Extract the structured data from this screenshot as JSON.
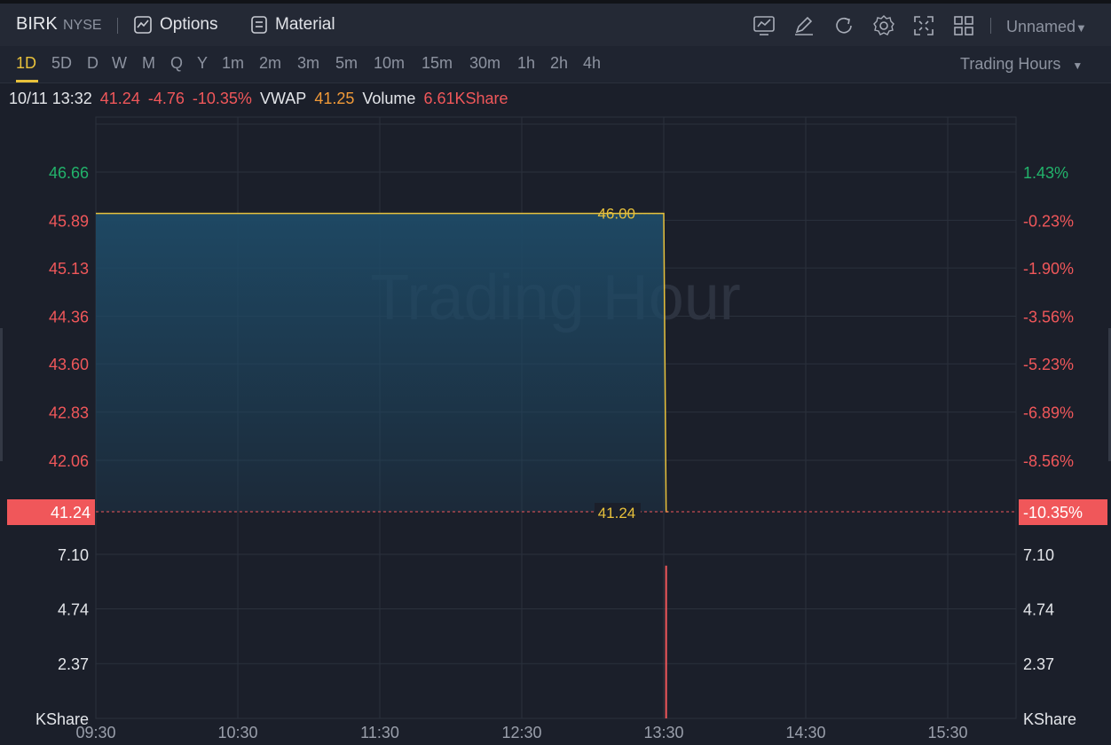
{
  "header": {
    "symbol": "BIRK",
    "exchange": "NYSE",
    "options_label": "Options",
    "material_label": "Material",
    "layout_name": "Unnamed",
    "tool_icons": [
      "indicator-icon",
      "draw-icon",
      "refresh-icon",
      "settings-icon",
      "fullscreen-icon",
      "layout-grid-icon"
    ]
  },
  "timeframes": [
    "1D",
    "5D",
    "D",
    "W",
    "M",
    "Q",
    "Y",
    "1m",
    "2m",
    "3m",
    "5m",
    "10m",
    "15m",
    "30m",
    "1h",
    "2h",
    "4h"
  ],
  "active_timeframe": "1D",
  "session_selector": "Trading Hours",
  "quote": {
    "datetime": "10/11 13:32",
    "price": "41.24",
    "change": "-4.76",
    "change_pct": "-10.35%",
    "vwap_label": "VWAP",
    "vwap_value": "41.25",
    "volume_label": "Volume",
    "volume_value": "6.61KShare"
  },
  "colors": {
    "up": "#22b36b",
    "down": "#f0575a",
    "price_line": "#e8c13b",
    "area_fill": "#1e4a66",
    "grid": "#2b313c",
    "volume_bar": "#f0575a"
  },
  "chart_data": {
    "type": "area",
    "watermark": "Trading Hour",
    "x_ticks": [
      "09:30",
      "10:30",
      "11:30",
      "12:30",
      "13:30",
      "14:30",
      "15:30"
    ],
    "price_axis": {
      "ticks": [
        "46.66",
        "45.89",
        "45.13",
        "44.36",
        "43.60",
        "42.83",
        "42.06"
      ],
      "tick_values": [
        46.66,
        45.89,
        45.13,
        44.36,
        43.6,
        42.83,
        42.06
      ],
      "current_label": "41.24",
      "ylim": [
        41.24,
        46.66
      ]
    },
    "pct_axis": {
      "ticks": [
        "1.43%",
        "-0.23%",
        "-1.90%",
        "-3.56%",
        "-5.23%",
        "-6.89%",
        "-8.56%"
      ],
      "current_label": "-10.35%"
    },
    "price_series": {
      "x": [
        "09:30",
        "13:30",
        "13:31",
        "13:32"
      ],
      "y": [
        46.0,
        46.0,
        41.24,
        41.24
      ]
    },
    "annotations": [
      {
        "label": "46.00",
        "value": 46.0
      },
      {
        "label": "41.24",
        "value": 41.24
      }
    ],
    "volume_axis": {
      "ticks": [
        "7.10",
        "4.74",
        "2.37"
      ],
      "tick_values": [
        7.1,
        4.74,
        2.37
      ],
      "unit": "KShare"
    },
    "volume_series": {
      "x": [
        "13:31"
      ],
      "y": [
        6.61
      ]
    }
  }
}
